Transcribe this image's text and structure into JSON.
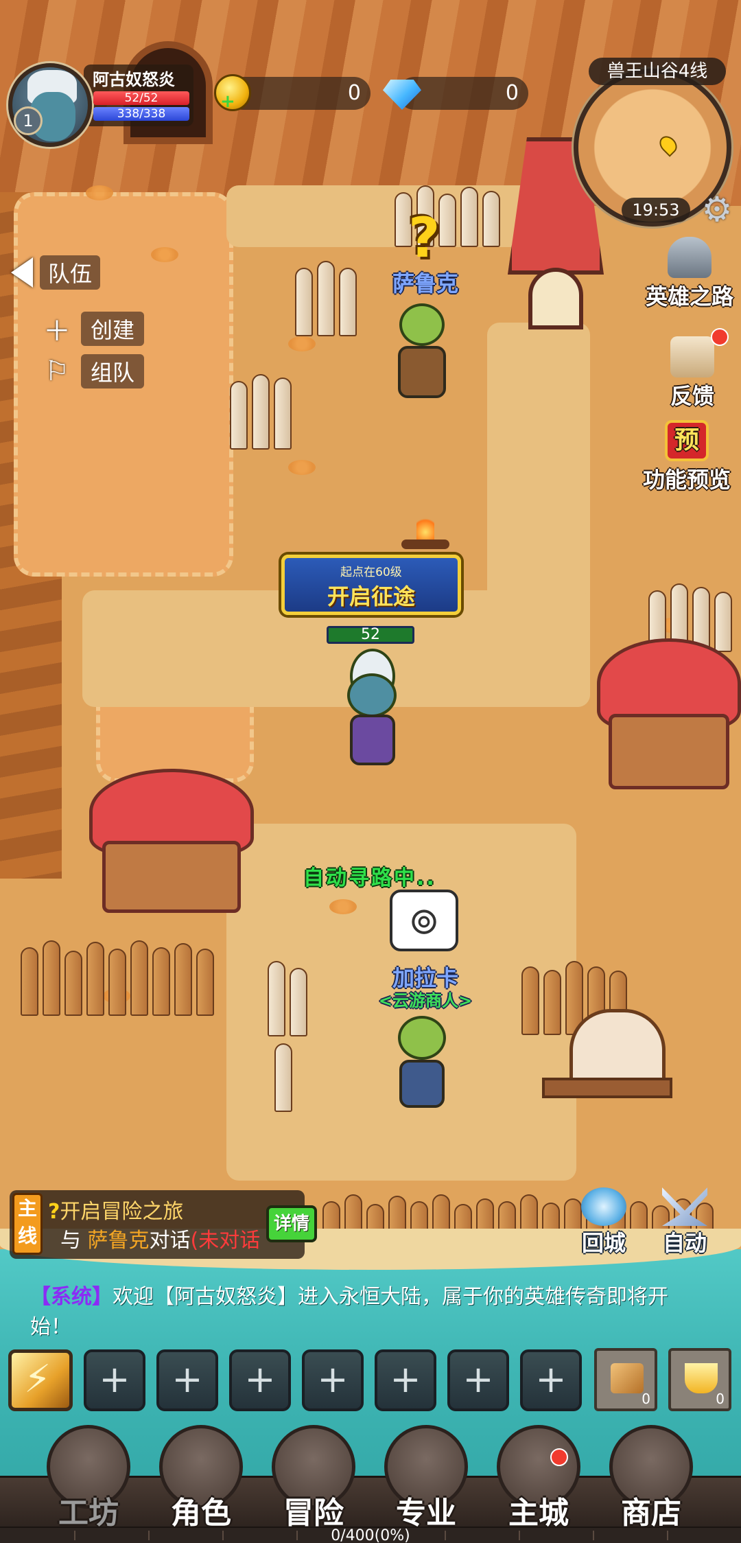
{
  "player": {
    "name": "阿古奴怒炎",
    "level": "1",
    "hp": "52/52",
    "mp": "338/338",
    "hp_overhead": "52"
  },
  "currency": {
    "gold": "0",
    "diamond": "0"
  },
  "minimap": {
    "zone": "兽王山谷4线",
    "time": "19:53"
  },
  "side_buttons": {
    "hero_road": "英雄之路",
    "feedback": "反馈",
    "preview": "功能预览",
    "preview_badge": "预"
  },
  "team": {
    "tab": "队伍",
    "create": "创建",
    "group": "组队"
  },
  "npcs": {
    "quest_giver": "萨鲁克",
    "merchant": "加拉卡",
    "merchant_title": "<云游商人>"
  },
  "banner": {
    "small": "起点在60级",
    "big": "开启征途"
  },
  "auto_path": "自动寻路中..",
  "quest": {
    "tag": "主线",
    "title": "开启冒险之旅",
    "desc_prefix": "与",
    "desc_npc": "萨鲁克",
    "desc_action": "对话",
    "desc_status": "(未对话",
    "detail": "详情"
  },
  "actions": {
    "return_city": "回城",
    "auto": "自动"
  },
  "chat": {
    "channel": "【系统】",
    "message": "欢迎【阿古奴怒炎】进入永恒大陆，属于你的英雄传奇即将开始！"
  },
  "skill_slots": [
    "+",
    "+",
    "+",
    "+",
    "+",
    "+",
    "+"
  ],
  "items": [
    {
      "count": "0"
    },
    {
      "count": "0"
    }
  ],
  "nav": [
    "工坊",
    "角色",
    "冒险",
    "专业",
    "主城",
    "商店"
  ],
  "exp": "0/400(0%)"
}
